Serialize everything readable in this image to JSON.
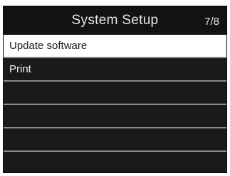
{
  "header": {
    "title": "System Setup",
    "page_indicator": "7/8"
  },
  "menu": {
    "selected_index": 0,
    "items": [
      {
        "label": "Update software"
      },
      {
        "label": "Print"
      },
      {
        "label": ""
      },
      {
        "label": ""
      },
      {
        "label": ""
      },
      {
        "label": ""
      }
    ]
  },
  "colors": {
    "screen_background": "#1a1a1a",
    "selected_background": "#ffffff",
    "separator": "#8a8a8a",
    "text_light": "#e6e6e6"
  }
}
